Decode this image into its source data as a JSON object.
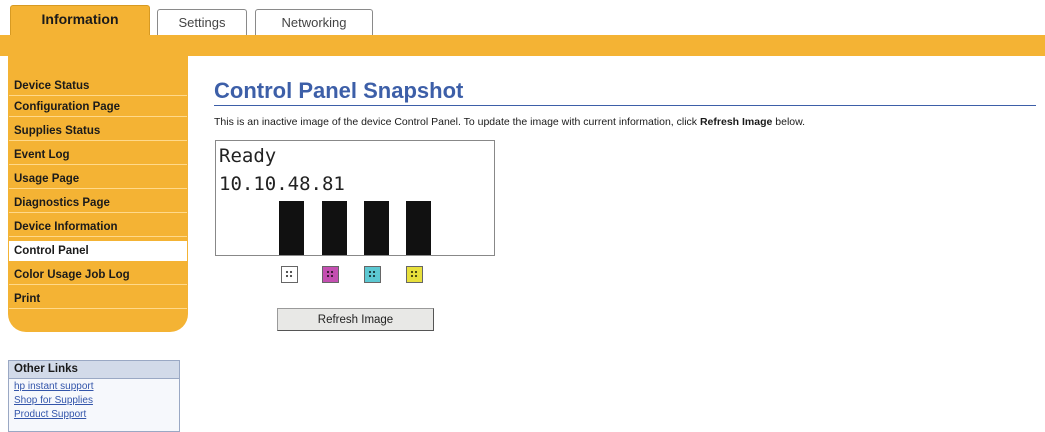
{
  "tabs": [
    {
      "label": "Information",
      "active": true
    },
    {
      "label": "Settings",
      "active": false
    },
    {
      "label": "Networking",
      "active": false
    }
  ],
  "sidebar": {
    "items": [
      {
        "label": "Device Status"
      },
      {
        "label": "Configuration Page"
      },
      {
        "label": "Supplies Status"
      },
      {
        "label": "Event Log"
      },
      {
        "label": "Usage Page"
      },
      {
        "label": "Diagnostics Page"
      },
      {
        "label": "Device Information"
      },
      {
        "label": "Control Panel",
        "selected": true
      },
      {
        "label": "Color Usage Job Log"
      },
      {
        "label": "Print"
      }
    ]
  },
  "other_links": {
    "title": "Other Links",
    "links": [
      "hp instant support",
      "Shop for Supplies",
      "Product Support"
    ]
  },
  "main": {
    "title": "Control Panel Snapshot",
    "description_prefix": "This is an inactive image of the device Control Panel. To update the image with current information, click ",
    "description_bold": "Refresh Image",
    "description_suffix": " below.",
    "display": {
      "line1": "Ready",
      "line2": "10.10.48.81"
    },
    "cartridges": [
      {
        "name": "black-cartridge-icon",
        "color": "#ffffff"
      },
      {
        "name": "magenta-cartridge-icon",
        "color": "#c44fb1"
      },
      {
        "name": "cyan-cartridge-icon",
        "color": "#5cc8d2"
      },
      {
        "name": "yellow-cartridge-icon",
        "color": "#e8e03c"
      }
    ],
    "refresh_label": "Refresh Image"
  },
  "colors": {
    "accent": "#f4b334",
    "title_blue": "#3d5fa8",
    "link_blue": "#3355aa"
  }
}
